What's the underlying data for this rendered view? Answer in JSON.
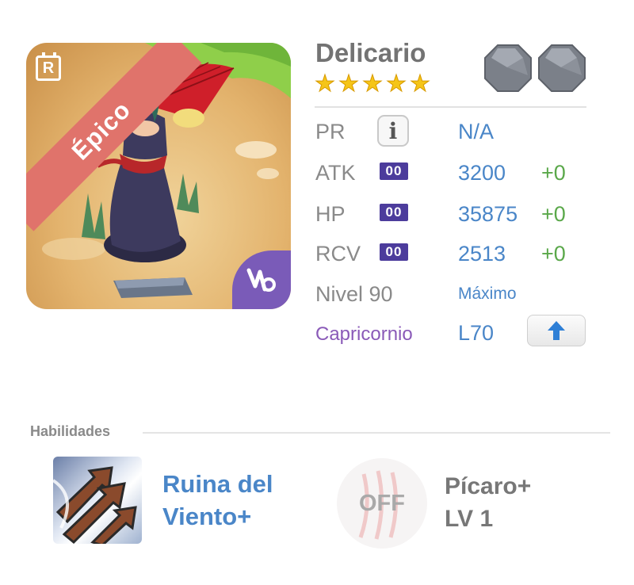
{
  "character": {
    "name": "Delicario",
    "stars": 5,
    "rarity": "Épico",
    "badge_letter": "R",
    "evolution_gems": 2
  },
  "stats": {
    "pr": {
      "label": "PR",
      "value": "N/A"
    },
    "atk": {
      "label": "ATK",
      "pill": "00",
      "value": "3200",
      "bonus": "+0"
    },
    "hp": {
      "label": "HP",
      "pill": "00",
      "value": "35875",
      "bonus": "+0"
    },
    "rcv": {
      "label": "RCV",
      "pill": "00",
      "value": "2513",
      "bonus": "+0"
    },
    "level": {
      "label": "Nivel 90",
      "value": "Máximo"
    },
    "sign": {
      "label": "Capricornio",
      "value": "L70"
    }
  },
  "skills": {
    "section_title": "Habilidades",
    "active": {
      "name_line1": "Ruina del",
      "name_line2": "Viento+"
    },
    "passive": {
      "status": "OFF",
      "name_line1": "Pícaro+",
      "name_line2": "LV 1"
    }
  },
  "colors": {
    "accent_blue": "#4a86c8",
    "bonus_green": "#5aa84a",
    "rarity_banner": "#e0736b",
    "zodiac_purple": "#7a5bb8",
    "stat_pill": "#4c3c9c",
    "star_gold": "#f5c518"
  },
  "icons": {
    "info": "info-icon",
    "upgrade": "arrow-up-icon",
    "zodiac": "capricorn-icon",
    "evolution": "octagon-stone-icon"
  }
}
